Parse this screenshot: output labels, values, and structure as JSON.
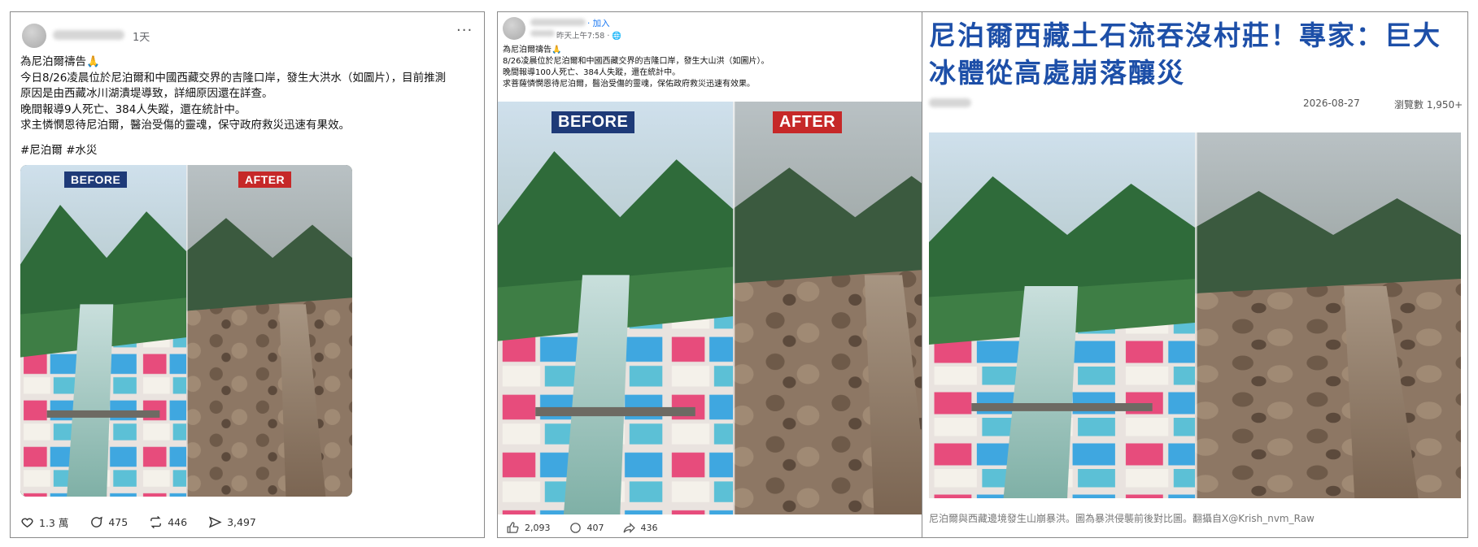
{
  "post1": {
    "time": "1天",
    "body": "為尼泊爾禱告🙏\n今日8/26凌晨位於尼泊爾和中國西藏交界的吉隆口岸，發生大洪水（如圖片），目前推測\n原因是由西藏冰川湖潰堤導致，詳細原因還在詳查。\n晚間報導9人死亡、384人失蹤，還在統計中。\n求主憐憫恩待尼泊爾，醫治受傷的靈魂，保守政府救災迅速有果效。",
    "hashtags": "#尼泊爾 #水災",
    "before_label": "BEFORE",
    "after_label": "AFTER",
    "likes": "1.3 萬",
    "comments": "475",
    "reposts": "446",
    "shares": "3,497"
  },
  "post2": {
    "follow": "· 加入",
    "time": "昨天上午7:58 · 🌐",
    "body": "為尼泊爾禱告🙏\n8/26凌晨位於尼泊爾和中國西藏交界的吉隆口岸，發生大山洪（如圖片）。\n晚間報導100人死亡、384人失蹤，還在統計中。\n求菩薩憐憫恩待尼泊爾，醫治受傷的靈魂，保佑政府救災迅速有效果。",
    "before_label": "BEFORE",
    "after_label": "AFTER",
    "likes": "2,093",
    "comments": "407",
    "shares": "436"
  },
  "article": {
    "headline": "尼泊爾西藏土石流吞沒村莊！專家：巨大冰體從高處崩落釀災",
    "date": "2026-08-27",
    "views": "瀏覽數 1,950+",
    "caption": "尼泊爾與西藏邊境發生山崩暴洪。圖為暴洪侵襲前後對比圖。翻攝自X@Krish_nvm_Raw"
  },
  "colors": {
    "before_badge": "#1e3a78",
    "after_badge": "#c62828",
    "headline": "#1d4fa8"
  },
  "icons": [
    "more-icon",
    "heart-icon",
    "comment-icon",
    "repost-icon",
    "send-icon",
    "like-icon",
    "share-icon",
    "globe-icon",
    "reactions-icon"
  ]
}
